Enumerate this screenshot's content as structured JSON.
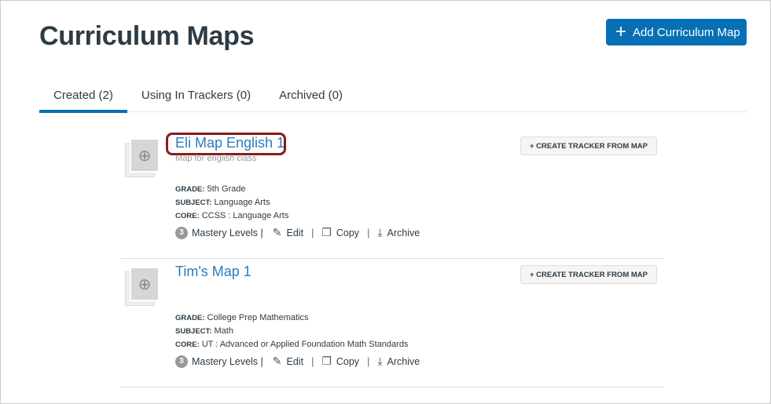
{
  "header": {
    "title": "Curriculum Maps",
    "add_button": "Add Curriculum Map"
  },
  "tabs": [
    {
      "label": "Created (2)"
    },
    {
      "label": "Using In Trackers (0)"
    },
    {
      "label": "Archived (0)"
    }
  ],
  "maps": [
    {
      "name": "Eli Map English 1",
      "description": "Map for english class",
      "grade_label": "GRADE:",
      "grade": "5th Grade",
      "subject_label": "SUBJECT:",
      "subject": "Language Arts",
      "core_label": "CORE:",
      "core": "CCSS : Language Arts",
      "mastery_count": "3",
      "mastery_label": "Mastery Levels |",
      "edit": "Edit",
      "copy": "Copy",
      "archive": "Archive",
      "tracker_button": "+ CREATE TRACKER FROM MAP"
    },
    {
      "name": "Tim's Map 1",
      "grade_label": "GRADE:",
      "grade": "College Prep Mathematics",
      "subject_label": "SUBJECT:",
      "subject": "Math",
      "core_label": "CORE:",
      "core": "UT : Advanced or Applied Foundation Math Standards",
      "mastery_count": "3",
      "mastery_label": "Mastery Levels |",
      "edit": "Edit",
      "copy": "Copy",
      "archive": "Archive",
      "tracker_button": "+ CREATE TRACKER FROM MAP"
    }
  ]
}
